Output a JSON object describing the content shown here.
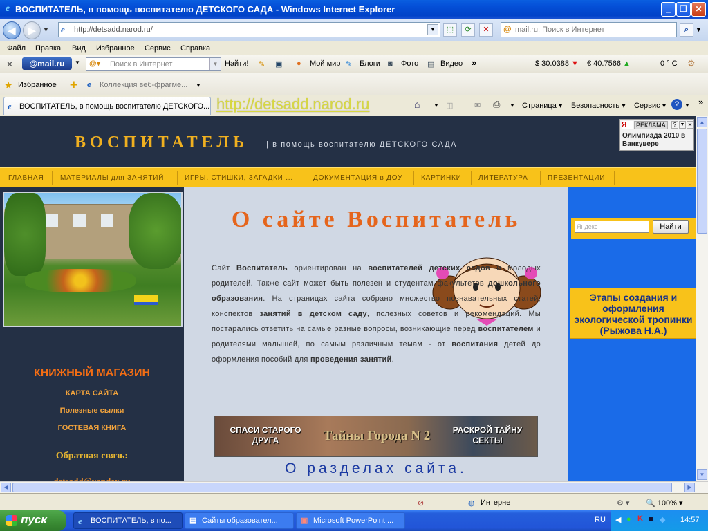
{
  "window": {
    "title": "ВОСПИТАТЕЛЬ, в помощь воспитателю ДЕТСКОГО САДА - Windows Internet Explorer"
  },
  "address": {
    "url": "http://detsadd.narod.ru/",
    "search_placeholder": "mail.ru: Поиск в Интернет"
  },
  "menu": [
    "Файл",
    "Правка",
    "Вид",
    "Избранное",
    "Сервис",
    "Справка"
  ],
  "mailbar": {
    "logo": "@mail.ru",
    "search_placeholder": "Поиск в Интернет",
    "find": "Найти!",
    "my_world": "Мой мир",
    "blogs": "Блоги",
    "photo": "Фото",
    "video": "Видео",
    "usd": "$ 30.0388",
    "eur": "€ 40.7566",
    "temp": "0 ° C"
  },
  "favbar": {
    "favorites": "Избранное",
    "gallery": "Коллекция веб-фрагме..."
  },
  "tabbar": {
    "tab_title": "ВОСПИТАТЕЛЬ, в помощь воспитателю ДЕТСКОГО...",
    "url_overlay": "http://detsadd.narod.ru",
    "page": "Страница",
    "safety": "Безопасность",
    "tools": "Сервис"
  },
  "site": {
    "brand": "ВОСПИТАТЕЛЬ",
    "tagline": "| в помощь воспитателю ДЕТСКОГО САДА",
    "nav": [
      "ГЛАВНАЯ",
      "МАТЕРИАЛЫ для ЗАНЯТИЙ",
      "ИГРЫ, СТИШКИ, ЗАГАДКИ ...",
      "ДОКУМЕНТАЦИЯ в ДОУ",
      "КАРТИНКИ",
      "ЛИТЕРАТУРА",
      "ПРЕЗЕНТАЦИИ"
    ],
    "bookshop": "КНИЖНЫЙ МАГАЗИН",
    "sitemap": "КАРТА САЙТА",
    "useful_links": "Полезные сылки",
    "guestbook": "ГОСТЕВАЯ КНИГА",
    "feedback": "Обратная связь:",
    "email": "detsadd@yandex.ru",
    "heading": "О сайте Воспитатель",
    "paragraph": {
      "p1": "Сайт ",
      "b1": "Воспитатель",
      "p2": " ориентирован на ",
      "b2": "воспитателей детских садов",
      "p3": " и молодых родителей. Также сайт может быть полезен и студентам факультетов ",
      "b3": "дошкольного образования",
      "p4": ". На страницах сайта собрано множество познавательных статей, конспектов ",
      "b4": "занятий в детском саду",
      "p5": ", полезных советов и рекомендаций. Мы постарались ответить на самые разные вопросы, возникающие перед ",
      "b5": "воспитателем",
      "p6": " и родителями малышей, по самым различным темам - от ",
      "b6": "воспитания",
      "p7": " детей до оформления пособий для ",
      "b7": "проведения занятий",
      "p8": "."
    },
    "banner_left": "СПАСИ СТАРОГО ДРУГА",
    "banner_mid": "Тайны Города N",
    "banner_mid_num": "2",
    "banner_right": "РАСКРОЙ ТАЙНУ СЕКТЫ",
    "sections": "О разделах сайта.",
    "yandex_placeholder": "Яндекс",
    "yandex_button": "Найти",
    "stages": "Этапы создания и оформления экологической тропинки (Рыжова Н.А.)"
  },
  "ad": {
    "label": "РЕКЛАМА",
    "text": "Олимпиада 2010 в Ванкувере"
  },
  "status": {
    "zone": "Интернет",
    "zoom": "100%"
  },
  "taskbar": {
    "start": "пуск",
    "items": [
      "ВОСПИТАТЕЛЬ, в по...",
      "Сайты образовател...",
      "Microsoft PowerPoint ..."
    ],
    "lang": "RU",
    "clock": "14:57"
  },
  "colors": {
    "header_bg": "#243045",
    "brand": "#f0b020",
    "nav_bg": "#f8c21a",
    "heading": "#e5651c",
    "page_bg": "#1a6be8"
  }
}
